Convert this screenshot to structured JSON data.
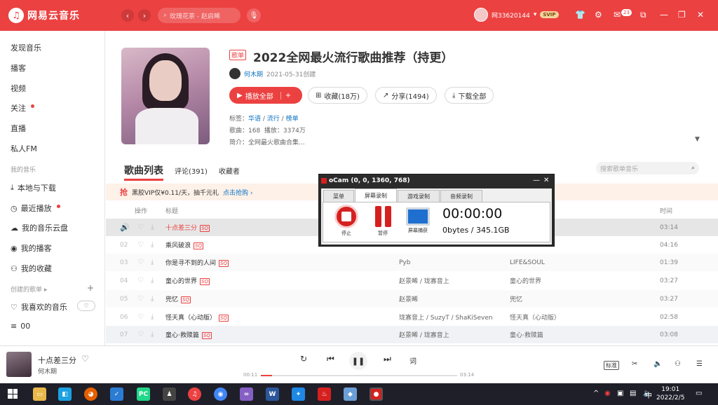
{
  "app": {
    "name": "网易云音乐"
  },
  "header": {
    "search_placeholder": "玫瑰花茶 - 赵启晞",
    "username": "网33620144",
    "vip_label": "SVIP",
    "message_count": "23"
  },
  "sidebar": {
    "items": [
      "发现音乐",
      "播客",
      "视频",
      "关注",
      "直播",
      "私人FM"
    ],
    "my_music_label": "我的音乐",
    "my_music": [
      "本地与下载",
      "最近播放",
      "我的音乐云盘",
      "我的播客",
      "我的收藏"
    ],
    "created_label": "创建的歌单",
    "created": [
      "我喜欢的音乐",
      "00"
    ]
  },
  "playlist": {
    "tag": "歌单",
    "title": "2022全网最火流行歌曲推荐（持更）",
    "creator": "何木期",
    "created_at": "2021-05-31创建",
    "play_all": "播放全部",
    "collect": "收藏(18万)",
    "share": "分享(1494)",
    "download_all": "下载全部",
    "tags_label": "标签：",
    "tags": [
      "华语",
      "流行",
      "榜单"
    ],
    "songs_label": "歌曲：168",
    "plays_label": "播放：3374万",
    "intro": "简介：全网最火歌曲合集..."
  },
  "tabs": {
    "songs": "歌曲列表",
    "comments": "评论(391)",
    "collectors": "收藏者"
  },
  "playlist_search_placeholder": "搜索歌单音乐",
  "vip_banner": {
    "icon": "抢",
    "text": "黑胶VIP仅¥0.11/天，抽千元礼",
    "link": "点击抢购 ›"
  },
  "table": {
    "headers": {
      "action": "操作",
      "title": "标题",
      "time": "时间"
    },
    "rows": [
      {
        "index": "",
        "title": "十点差三分",
        "artist": "",
        "album": "",
        "duration": "03:14",
        "playing": true
      },
      {
        "index": "02",
        "title": "乘风破浪",
        "artist": "",
        "album": "",
        "duration": "04:16"
      },
      {
        "index": "03",
        "title": "你是寻不到的人间",
        "artist": "Pyb",
        "album": "LIFE&SOUL",
        "duration": "01:39"
      },
      {
        "index": "04",
        "title": "童心的世界",
        "artist": "赵景晞 / 珑寡音上",
        "album": "童心的世界",
        "duration": "03:27"
      },
      {
        "index": "05",
        "title": "兜忆",
        "artist": "赵景晞",
        "album": "兜忆",
        "duration": "03:27"
      },
      {
        "index": "06",
        "title": "怪天真（心动版）",
        "artist": "珑寡音上 / SuzyT / ShaKiSeven",
        "album": "怪天真（心动版）",
        "duration": "02:58"
      },
      {
        "index": "07",
        "title": "童心·救赎篇",
        "artist": "赵景晞 / 珑寡音上",
        "album": "童心·救赎篇",
        "duration": "03:08"
      }
    ]
  },
  "player": {
    "song": "十点差三分",
    "artist": "何木期",
    "current": "00:11",
    "total": "03:14",
    "progress": 0.057,
    "lyrics_label": "词",
    "quality": "标准"
  },
  "ocam": {
    "title": "oCam (0, 0, 1360, 768)",
    "tabs": [
      "菜单",
      "屏幕录制",
      "游戏录制",
      "音频录制"
    ],
    "buttons": [
      "停止",
      "暂停",
      "屏幕捕获"
    ],
    "time": "00:00:00",
    "size": "0bytes / 345.1GB"
  },
  "taskbar": {
    "time": "19:01",
    "date": "2022/2/5",
    "ime": "中"
  }
}
